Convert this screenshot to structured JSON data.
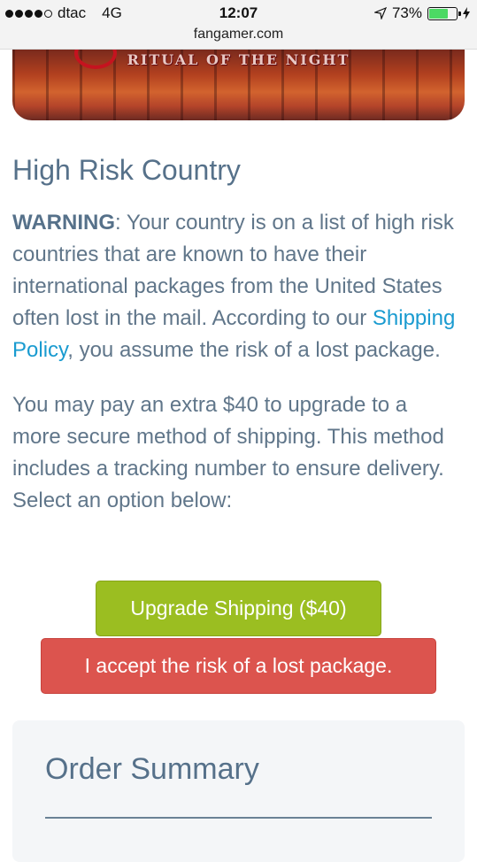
{
  "status_bar": {
    "carrier": "dtac",
    "network": "4G",
    "time": "12:07",
    "battery_percent": "73%",
    "battery_level": 0.73,
    "signal_bars_filled": 4,
    "signal_bars_total": 5
  },
  "browser": {
    "url": "fangamer.com"
  },
  "banner": {
    "text": "RITUAL OF THE NIGHT"
  },
  "page": {
    "title": "High Risk Country",
    "warning_label": "WARNING",
    "warning_text_1": ": Your country is on a list of high risk countries that are known to have their international packages from the United States often lost in the mail. According to our ",
    "shipping_policy_link": "Shipping Policy",
    "warning_text_2": ", you assume the risk of a lost package.",
    "upgrade_paragraph": "You may pay an extra $40 to upgrade to a more secure method of shipping. This method includes a tracking number to ensure delivery. Select an option below:"
  },
  "actions": {
    "upgrade_label": "Upgrade Shipping ($40)",
    "accept_label": "I accept the risk of a lost package."
  },
  "summary": {
    "title": "Order Summary"
  },
  "colors": {
    "heading": "#56718a",
    "link": "#1a9bd0",
    "upgrade_button": "#9bbe21",
    "accept_button": "#dc544e",
    "battery": "#4cd964"
  }
}
